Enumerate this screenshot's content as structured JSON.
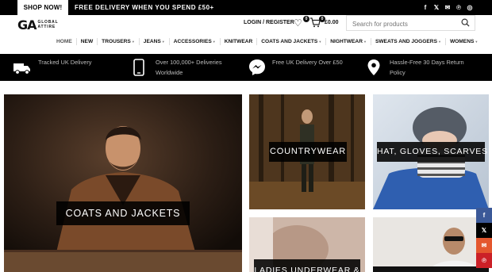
{
  "topbar": {
    "shop_now": "SHOP NOW!",
    "promo": "FREE DELIVERY WHEN YOU SPEND £50+",
    "social_icons": [
      "facebook-icon",
      "x-icon",
      "email-icon",
      "pinterest-icon",
      "whatsapp-icon"
    ]
  },
  "header": {
    "logo_mark": "GA",
    "logo_line1": "GLOBAL",
    "logo_line2": "ATTIRE",
    "login": "LOGIN / REGISTER",
    "wishlist_count": "0",
    "cart_count": "0",
    "cart_total": "£0.00",
    "search_placeholder": "Search for products"
  },
  "nav": {
    "items": [
      {
        "label": "HOME",
        "active": true,
        "caret": false
      },
      {
        "label": "NEW",
        "active": false,
        "caret": false
      },
      {
        "label": "TROUSERS",
        "active": false,
        "caret": true
      },
      {
        "label": "JEANS",
        "active": false,
        "caret": true
      },
      {
        "label": "ACCESSORIES",
        "active": false,
        "caret": true
      },
      {
        "label": "KNITWEAR",
        "active": false,
        "caret": false
      },
      {
        "label": "COATS AND JACKETS",
        "active": false,
        "caret": true
      },
      {
        "label": "NIGHTWEAR",
        "active": false,
        "caret": true
      },
      {
        "label": "SWEATS AND JOGGERS",
        "active": false,
        "caret": true
      },
      {
        "label": "WOMENS",
        "active": false,
        "caret": true
      }
    ]
  },
  "features": [
    {
      "icon": "delivery-truck-icon",
      "line1": "Tracked UK Delivery",
      "line2": ""
    },
    {
      "icon": "phone-icon",
      "line1": "Over 100,000+ Deliveries",
      "line2": "Worldwide"
    },
    {
      "icon": "messenger-icon",
      "line1": "Free UK Delivery Over £50",
      "line2": ""
    },
    {
      "icon": "location-pin-icon",
      "line1": "Hassle-Free 30 Days Return",
      "line2": "Policy"
    }
  ],
  "tiles": {
    "coats": "COATS AND JACKETS",
    "countrywear": "COUNTRYWEAR",
    "hats": "HAT, GLOVES, SCARVES",
    "ladies": "LADIES UNDERWEAR &"
  },
  "share": [
    "facebook-icon",
    "x-icon",
    "email-icon",
    "pinterest-icon"
  ],
  "colors": {
    "black": "#000000",
    "facebook": "#3b5998",
    "x": "#000000",
    "email": "#e4572e",
    "pinterest": "#cb2027"
  }
}
